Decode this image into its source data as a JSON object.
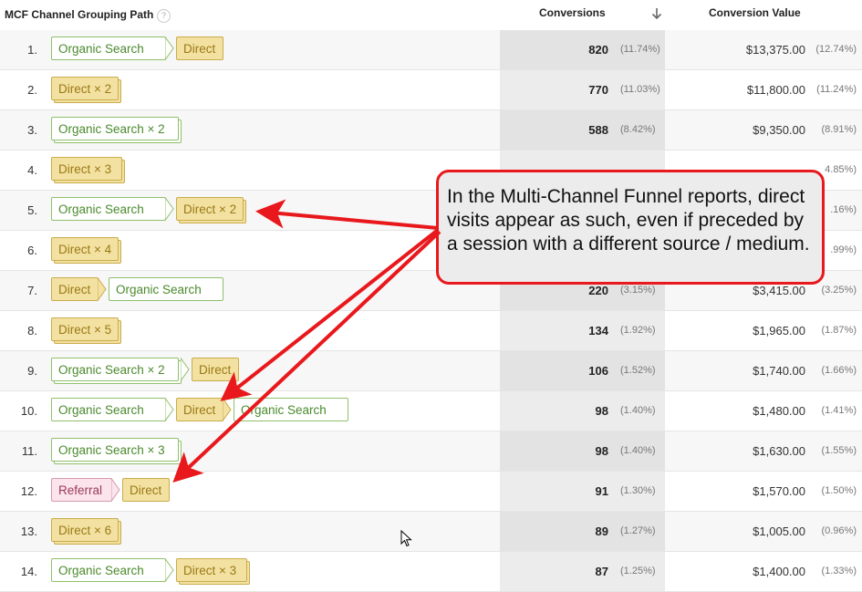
{
  "header": {
    "title": "MCF Channel Grouping Path",
    "help": "?",
    "conversions": "Conversions",
    "conversion_value": "Conversion Value"
  },
  "rows": [
    {
      "idx": "1.",
      "conv": "820",
      "conv_pct": "(11.74%)",
      "value": "$13,375.00",
      "value_pct": "(12.74%)"
    },
    {
      "idx": "2.",
      "conv": "770",
      "conv_pct": "(11.03%)",
      "value": "$11,800.00",
      "value_pct": "(11.24%)"
    },
    {
      "idx": "3.",
      "conv": "588",
      "conv_pct": "(8.42%)",
      "value": "$9,350.00",
      "value_pct": "(8.91%)"
    },
    {
      "idx": "4.",
      "conv": "",
      "conv_pct": "",
      "value": "",
      "value_pct": "4.85%)"
    },
    {
      "idx": "5.",
      "conv": "",
      "conv_pct": "",
      "value": "",
      "value_pct": ".16%)"
    },
    {
      "idx": "6.",
      "conv": "",
      "conv_pct": "",
      "value": "",
      "value_pct": ".99%)"
    },
    {
      "idx": "7.",
      "conv": "220",
      "conv_pct": "(3.15%)",
      "value": "$3,415.00",
      "value_pct": "(3.25%)"
    },
    {
      "idx": "8.",
      "conv": "134",
      "conv_pct": "(1.92%)",
      "value": "$1,965.00",
      "value_pct": "(1.87%)"
    },
    {
      "idx": "9.",
      "conv": "106",
      "conv_pct": "(1.52%)",
      "value": "$1,740.00",
      "value_pct": "(1.66%)"
    },
    {
      "idx": "10.",
      "conv": "98",
      "conv_pct": "(1.40%)",
      "value": "$1,480.00",
      "value_pct": "(1.41%)"
    },
    {
      "idx": "11.",
      "conv": "98",
      "conv_pct": "(1.40%)",
      "value": "$1,630.00",
      "value_pct": "(1.55%)"
    },
    {
      "idx": "12.",
      "conv": "91",
      "conv_pct": "(1.30%)",
      "value": "$1,570.00",
      "value_pct": "(1.50%)"
    },
    {
      "idx": "13.",
      "conv": "89",
      "conv_pct": "(1.27%)",
      "value": "$1,005.00",
      "value_pct": "(0.96%)"
    },
    {
      "idx": "14.",
      "conv": "87",
      "conv_pct": "(1.25%)",
      "value": "$1,400.00",
      "value_pct": "(1.33%)"
    }
  ],
  "chips": {
    "organic": "Organic Search",
    "direct": "Direct",
    "referral": "Referral",
    "organic_x2": "Organic Search × 2",
    "organic_x3": "Organic Search × 3",
    "direct_x2": "Direct × 2",
    "direct_x3": "Direct × 3",
    "direct_x4": "Direct × 4",
    "direct_x5": "Direct × 5",
    "direct_x6": "Direct × 6"
  },
  "callout": {
    "text": "In the Multi-Channel Funnel reports, direct visits appear as such, even if preceded by a session with a different source / medium."
  },
  "colors": {
    "organic_text": "#4a8a2c",
    "organic_border": "#8fc06a",
    "direct_text": "#9a7a16",
    "direct_bg": "#f3e1a1",
    "referral_text": "#9a3a5a",
    "referral_bg": "#fbe4ec",
    "callout_border": "#e8181c",
    "arrow": "#e8181c"
  },
  "icons": {
    "sort": "arrow-down-icon",
    "cursor": "mouse-cursor-icon",
    "help": "question-icon"
  }
}
